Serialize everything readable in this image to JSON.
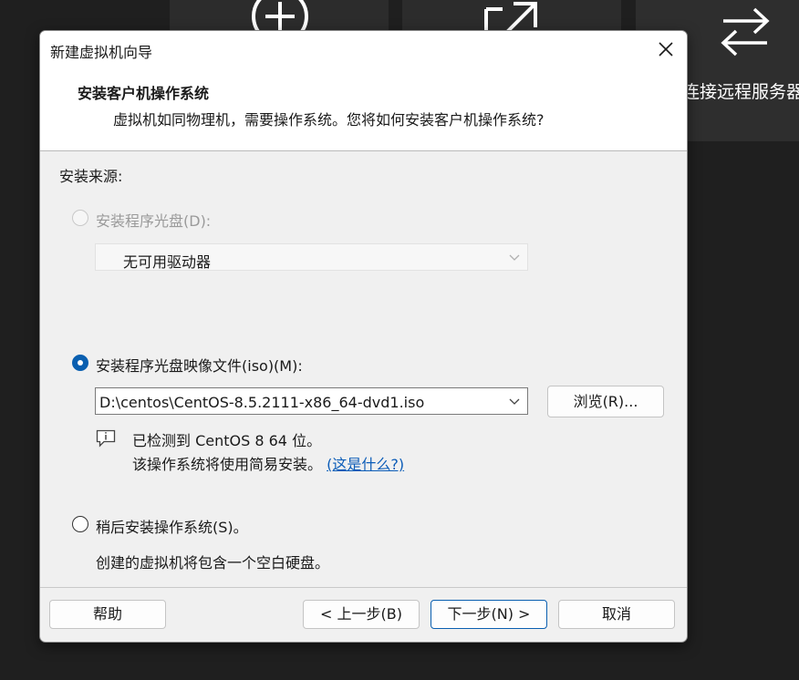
{
  "background": {
    "tile3_label": "连接远程服务器",
    "icons": [
      "plus-circle-icon",
      "open-external-icon",
      "swap-arrows-icon"
    ]
  },
  "dialog": {
    "title": "新建虚拟机向导",
    "header": {
      "title": "安装客户机操作系统",
      "subtitle": "虚拟机如同物理机，需要操作系统。您将如何安装客户机操作系统?"
    },
    "install_source_label": "安装来源:",
    "options": {
      "disc": {
        "label": "安装程序光盘(D):",
        "enabled": false,
        "selected": false,
        "dropdown_value": "无可用驱动器"
      },
      "iso": {
        "label": "安装程序光盘映像文件(iso)(M):",
        "selected": true,
        "path_value": "D:\\centos\\CentOS-8.5.2111-x86_64-dvd1.iso",
        "browse_label": "浏览(R)...",
        "detected_text": "已检测到 CentOS 8 64 位。",
        "easy_install_text": "该操作系统将使用简易安装。",
        "whats_this_link": "(这是什么?)"
      },
      "later": {
        "label": "稍后安装操作系统(S)。",
        "selected": false,
        "description": "创建的虚拟机将包含一个空白硬盘。"
      }
    },
    "buttons": {
      "help": "帮助",
      "back": "< 上一步(B)",
      "next": "下一步(N) >",
      "cancel": "取消"
    },
    "colors": {
      "accent": "#0a5fb0",
      "link": "#0b5cb8"
    }
  }
}
